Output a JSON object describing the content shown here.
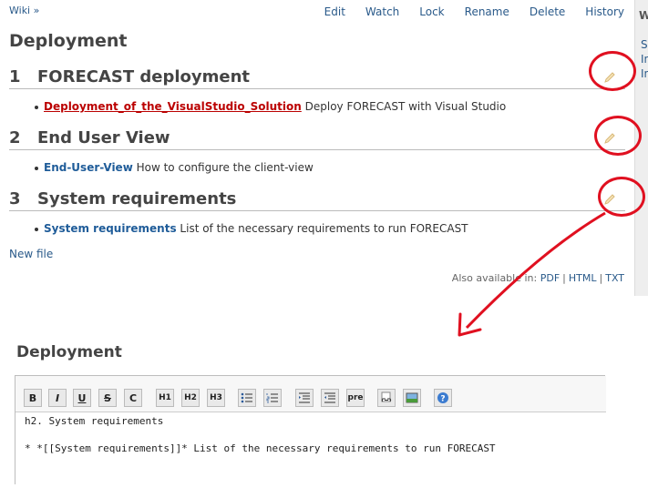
{
  "top_view": {
    "breadcrumb": "Wiki »",
    "toolbar": [
      "Edit",
      "Watch",
      "Lock",
      "Rename",
      "Delete",
      "History"
    ],
    "sidebar_heading": "W",
    "sidebar_links": [
      "S",
      "In",
      "In"
    ],
    "page_title": "Deployment",
    "sections": [
      {
        "number": "1",
        "heading": "FORECAST deployment",
        "link_text": "Deployment_of_the_VisualStudio_Solution",
        "description": "Deploy FORECAST with Visual Studio",
        "link_state": "missing"
      },
      {
        "number": "2",
        "heading": "End User View",
        "link_text": "End-User-View",
        "description": "How to configure the client-view",
        "link_state": "existing"
      },
      {
        "number": "3",
        "heading": "System requirements",
        "link_text": "System requirements",
        "description": "List of the necessary requirements to run FORECAST",
        "link_state": "existing"
      }
    ],
    "new_file": "New file",
    "also_available_label": "Also available in:",
    "formats": [
      "PDF",
      "HTML",
      "TXT"
    ],
    "section_edit_icon": "pencil-icon",
    "annotation_color": "#e01020"
  },
  "edit_view": {
    "title": "Deployment",
    "toolbar_buttons": [
      "B",
      "I",
      "U",
      "S",
      "C",
      "H1",
      "H2",
      "H3",
      "ul",
      "ol",
      "indent-right",
      "indent-left",
      "pre",
      "link",
      "image",
      "help"
    ],
    "textarea_line1": "h2. System requirements",
    "textarea_line2": "",
    "textarea_line3": "* *[[System requirements]]* List of the necessary requirements to run FORECAST"
  }
}
